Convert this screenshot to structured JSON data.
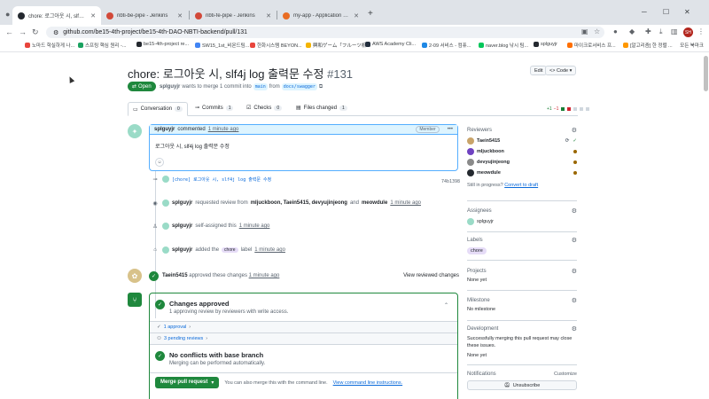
{
  "browser": {
    "tabs": [
      {
        "title": "chore: 로그아웃 시, slf4j lo",
        "active": true,
        "favicon_color": "#24292f"
      },
      {
        "title": "nbti-be-pipe - Jenkins",
        "active": false,
        "favicon_color": "#d24939"
      },
      {
        "title": "nbti-fe-pipe - Jenkins",
        "active": false,
        "favicon_color": "#d24939"
      },
      {
        "title": "my-app - Application Detail",
        "active": false,
        "favicon_color": "#e96d23"
      }
    ],
    "new_tab": "+",
    "url": "github.com/be15-4th-project/be15-4th-DAO-NBTI-backend/pull/131",
    "profile_initial": "SH",
    "bookmarks": [
      {
        "label": "노마드 학실하게 나...",
        "color": "#e8453c"
      },
      {
        "label": "스프링 핵심 원리 -...",
        "color": "#1aa260"
      },
      {
        "label": "be15-4th-project re...",
        "color": "#24292f"
      },
      {
        "label": "SW15_1st_비욘드팀...",
        "color": "#4285f4"
      },
      {
        "label": "한화시스템 BEYON...",
        "color": "#e8453c"
      },
      {
        "label": "興和ゲーム「フルーツ析...",
        "color": "#f4b400"
      },
      {
        "label": "AWS Academy Cli...",
        "color": "#232f3e"
      },
      {
        "label": "2-09 서비스 - 컴퓨...",
        "color": "#1e88e5"
      },
      {
        "label": "naver.blog 낚시 팀...",
        "color": "#03c75a"
      },
      {
        "label": "splguyjr",
        "color": "#24292f"
      },
      {
        "label": "마이크로서비스 프...",
        "color": "#ff6f00"
      },
      {
        "label": "[알고리즘] 한 정렬 ...",
        "color": "#ff9800"
      }
    ],
    "all_bookmarks": "모든 북마크"
  },
  "pr": {
    "title": "chore: 로그아웃 시, slf4j log 출력문 수정",
    "number": "#131",
    "edit_label": "Edit",
    "code_label": "<> Code ▾",
    "state": "Open",
    "author": "splguyjr",
    "merge_text": "wants to merge 1 commit into",
    "base_branch": "main",
    "from_text": "from",
    "head_branch": "docs/swagger"
  },
  "tabs": [
    {
      "label": "Conversation",
      "count": "0"
    },
    {
      "label": "Commits",
      "count": "1"
    },
    {
      "label": "Checks",
      "count": "0"
    },
    {
      "label": "Files changed",
      "count": "1"
    }
  ],
  "diffstat": {
    "add": "+1",
    "del": "−1"
  },
  "comment": {
    "author": "splguyjr",
    "action": "commented",
    "time": "1 minute ago",
    "badge": "Member",
    "body": "로그아웃 시, slf4j log 출력문 수정"
  },
  "events": {
    "commit": {
      "message": "[chore] 로그아웃 시, slf4j log 출력문 수정",
      "sha": "74b1398"
    },
    "review_request": {
      "actor": "splguyjr",
      "text": "requested review from",
      "users": "mljuckboon, Taein5415, devyujinjeong",
      "and": "and",
      "last": "meowdule",
      "time": "1 minute ago"
    },
    "self_assigned": {
      "actor": "splguyjr",
      "text": "self-assigned this",
      "time": "1 minute ago"
    },
    "label": {
      "actor": "splguyjr",
      "text": "added the",
      "label": "chore",
      "suffix": "label",
      "time": "1 minute ago"
    },
    "approval": {
      "actor": "Taein5415",
      "text": "approved these changes",
      "time": "1 minute ago",
      "view": "View reviewed changes"
    }
  },
  "merge": {
    "approved_title": "Changes approved",
    "approved_sub": "1 approving review by reviewers with write access.",
    "approval_row": "1 approval",
    "pending_row": "3 pending reviews",
    "conflict_title": "No conflicts with base branch",
    "conflict_sub": "Merging can be performed automatically.",
    "button": "Merge pull request",
    "hint": "You can also merge this with the command line.",
    "hint_link": "View command line instructions."
  },
  "sidebar": {
    "reviewers_title": "Reviewers",
    "reviewers": [
      {
        "name": "Taein5415",
        "color": "#c9a46a"
      },
      {
        "name": "mljuckboon",
        "color": "#6f42c1"
      },
      {
        "name": "devyujinjeong",
        "color": "#8a8a8a"
      },
      {
        "name": "meowdule",
        "color": "#24292f"
      }
    ],
    "still_progress": "Still in progress?",
    "convert_draft": "Convert to draft",
    "assignees_title": "Assignees",
    "assignee": "splguyjr",
    "labels_title": "Labels",
    "label": "chore",
    "projects_title": "Projects",
    "projects_value": "None yet",
    "milestone_title": "Milestone",
    "milestone_value": "No milestone",
    "development_title": "Development",
    "development_text": "Successfully merging this pull request may close these issues.",
    "development_value": "None yet",
    "notifications_title": "Notifications",
    "customize": "Customize",
    "unsubscribe": "Unsubscribe"
  },
  "colors": {
    "green": "#1f883d",
    "blue": "#0969da",
    "border": "#d0d7de"
  }
}
